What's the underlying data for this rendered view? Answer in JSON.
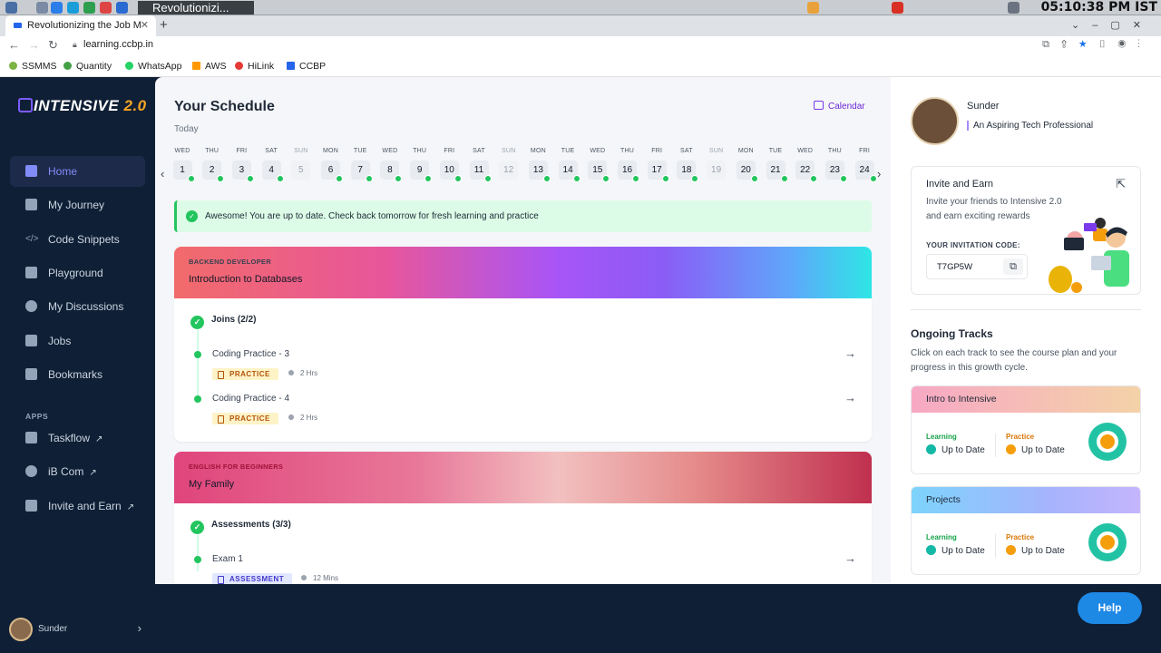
{
  "os": {
    "window_title": "Revolutionizi...",
    "clock": "05:10:38 PM IST"
  },
  "browser": {
    "tab_title": "Revolutionizing the Job M",
    "url": "learning.ccbp.in",
    "bookmarks": [
      "SSMMS",
      "Quantity",
      "WhatsApp",
      "AWS",
      "HiLink",
      "CCBP"
    ]
  },
  "sidebar": {
    "logo": {
      "text": "INTENSIVE",
      "version": "2.0"
    },
    "items": [
      "Home",
      "My Journey",
      "Code Snippets",
      "Playground",
      "My Discussions",
      "Jobs",
      "Bookmarks"
    ],
    "apps_label": "APPS",
    "apps": [
      "Taskflow",
      "iB Com",
      "Invite and Earn"
    ],
    "user": "Sunder"
  },
  "schedule": {
    "title": "Your Schedule",
    "today": "Today",
    "calendar": "Calendar",
    "days": [
      {
        "n": "WED",
        "d": "1"
      },
      {
        "n": "THU",
        "d": "2"
      },
      {
        "n": "FRI",
        "d": "3"
      },
      {
        "n": "SAT",
        "d": "4"
      },
      {
        "n": "SUN",
        "d": "5"
      },
      {
        "n": "MON",
        "d": "6"
      },
      {
        "n": "TUE",
        "d": "7"
      },
      {
        "n": "WED",
        "d": "8"
      },
      {
        "n": "THU",
        "d": "9"
      },
      {
        "n": "FRI",
        "d": "10"
      },
      {
        "n": "SAT",
        "d": "11"
      },
      {
        "n": "SUN",
        "d": "12"
      },
      {
        "n": "MON",
        "d": "13"
      },
      {
        "n": "TUE",
        "d": "14"
      },
      {
        "n": "WED",
        "d": "15"
      },
      {
        "n": "THU",
        "d": "16"
      },
      {
        "n": "FRI",
        "d": "17"
      },
      {
        "n": "SAT",
        "d": "18"
      },
      {
        "n": "SUN",
        "d": "19"
      },
      {
        "n": "MON",
        "d": "20"
      },
      {
        "n": "TUE",
        "d": "21"
      },
      {
        "n": "WED",
        "d": "22"
      },
      {
        "n": "THU",
        "d": "23"
      },
      {
        "n": "FRI",
        "d": "24"
      }
    ],
    "banner": "Awesome! You are up to date. Check back tomorrow for fresh learning and practice"
  },
  "cards": [
    {
      "overline": "BACKEND DEVELOPER",
      "title": "Introduction to Databases",
      "section": "Joins (2/2)",
      "items": [
        {
          "name": "Coding Practice - 3",
          "badge": "PRACTICE",
          "duration": "2 Hrs"
        },
        {
          "name": "Coding Practice - 4",
          "badge": "PRACTICE",
          "duration": "2 Hrs"
        }
      ]
    },
    {
      "overline": "ENGLISH FOR BEGINNERS",
      "title": "My Family",
      "section": "Assessments (3/3)",
      "items": [
        {
          "name": "Exam 1",
          "badge": "ASSESSMENT",
          "duration": "12 Mins"
        }
      ]
    }
  ],
  "profile": {
    "name": "Sunder",
    "tagline": "An Aspiring Tech Professional"
  },
  "invite": {
    "title": "Invite and Earn",
    "desc": "Invite your friends to Intensive 2.0 and earn exciting rewards",
    "code_label": "YOUR INVITATION CODE:",
    "code": "T7GP5W"
  },
  "tracks": {
    "title": "Ongoing Tracks",
    "desc": "Click on each track to see the course plan and your progress in this growth cycle.",
    "list": [
      {
        "name": "Intro to Intensive",
        "learning_label": "Learning",
        "learning": "Up to Date",
        "practice_label": "Practice",
        "practice": "Up to Date"
      },
      {
        "name": "Projects",
        "learning_label": "Learning",
        "learning": "Up to Date",
        "practice_label": "Practice",
        "practice": "Up to Date"
      }
    ]
  },
  "help": "Help",
  "colors": {
    "accent": "#818cf8",
    "success": "#22c55e",
    "sidebar_bg": "#0f1f35",
    "help": "#1e88e5"
  }
}
